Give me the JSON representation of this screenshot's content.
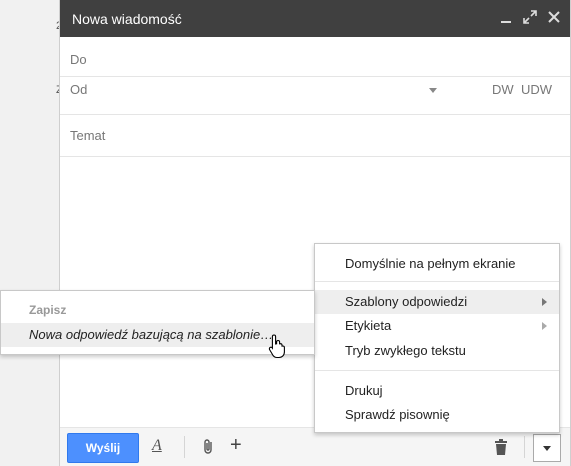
{
  "compose": {
    "title": "Nowa wiadomość",
    "to_label": "Do",
    "from_label": "Od",
    "cc_label": "DW",
    "bcc_label": "UDW",
    "subject_placeholder": "Temat",
    "send_label": "Wyślij"
  },
  "background": {
    "marks": [
      "2",
      "Z"
    ]
  },
  "more_menu": {
    "items": [
      {
        "label": "Domyślnie na pełnym ekranie"
      },
      {
        "label": "Szablony odpowiedzi"
      },
      {
        "label": "Etykieta"
      },
      {
        "label": "Tryb zwykłego tekstu"
      },
      {
        "label": "Drukuj"
      },
      {
        "label": "Sprawdź pisownię"
      }
    ]
  },
  "templates_submenu": {
    "header": "Zapisz",
    "item": "Nowa odpowiedź bazującą na szablonie…"
  },
  "icons": {
    "titlebar": [
      "minimize-icon",
      "expand-icon",
      "close-icon"
    ],
    "bottombar": [
      "text-format-icon",
      "attach-icon",
      "plus-icon",
      "trash-icon",
      "chevron-down-icon"
    ]
  },
  "colors": {
    "titlebar": "#404040",
    "send_button": "#4d90fe",
    "menu_highlight": "#eeeeee"
  }
}
